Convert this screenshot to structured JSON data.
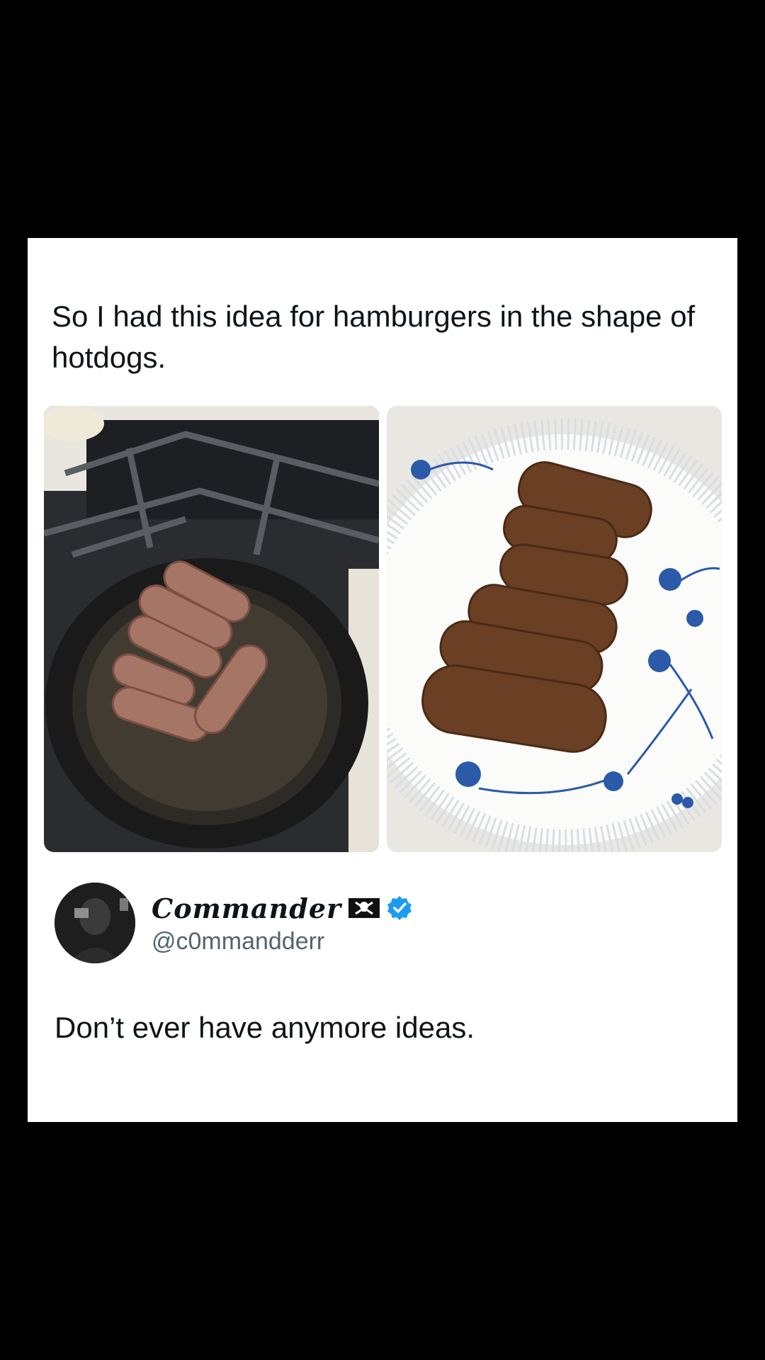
{
  "post": {
    "text": "So I had this idea for hamburgers in the shape of hotdogs."
  },
  "images": [
    {
      "icon": "skillet-photo-icon"
    },
    {
      "icon": "plate-photo-icon"
    }
  ],
  "author": {
    "display_name": "Commander",
    "handle": "@c0mmandderr",
    "flag_icon": "pirate-flag-icon",
    "verified_icon": "verified-badge-icon",
    "verified_color": "#1d9bf0"
  },
  "reply": {
    "text": "Don’t ever have anymore ideas."
  },
  "colors": {
    "background": "#000000",
    "card": "#ffffff",
    "text": "#0f1419",
    "secondary_text": "#536471"
  }
}
